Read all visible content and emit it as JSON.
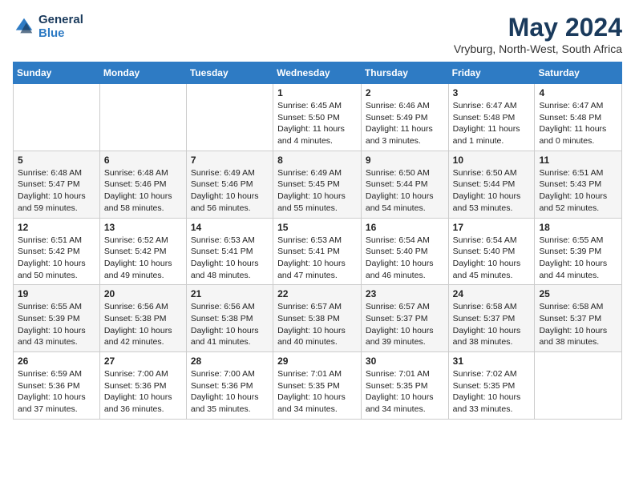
{
  "header": {
    "logo_line1": "General",
    "logo_line2": "Blue",
    "title": "May 2024",
    "location": "Vryburg, North-West, South Africa"
  },
  "days_of_week": [
    "Sunday",
    "Monday",
    "Tuesday",
    "Wednesday",
    "Thursday",
    "Friday",
    "Saturday"
  ],
  "weeks": [
    [
      {
        "day": "",
        "info": ""
      },
      {
        "day": "",
        "info": ""
      },
      {
        "day": "",
        "info": ""
      },
      {
        "day": "1",
        "info": "Sunrise: 6:45 AM\nSunset: 5:50 PM\nDaylight: 11 hours\nand 4 minutes."
      },
      {
        "day": "2",
        "info": "Sunrise: 6:46 AM\nSunset: 5:49 PM\nDaylight: 11 hours\nand 3 minutes."
      },
      {
        "day": "3",
        "info": "Sunrise: 6:47 AM\nSunset: 5:48 PM\nDaylight: 11 hours\nand 1 minute."
      },
      {
        "day": "4",
        "info": "Sunrise: 6:47 AM\nSunset: 5:48 PM\nDaylight: 11 hours\nand 0 minutes."
      }
    ],
    [
      {
        "day": "5",
        "info": "Sunrise: 6:48 AM\nSunset: 5:47 PM\nDaylight: 10 hours\nand 59 minutes."
      },
      {
        "day": "6",
        "info": "Sunrise: 6:48 AM\nSunset: 5:46 PM\nDaylight: 10 hours\nand 58 minutes."
      },
      {
        "day": "7",
        "info": "Sunrise: 6:49 AM\nSunset: 5:46 PM\nDaylight: 10 hours\nand 56 minutes."
      },
      {
        "day": "8",
        "info": "Sunrise: 6:49 AM\nSunset: 5:45 PM\nDaylight: 10 hours\nand 55 minutes."
      },
      {
        "day": "9",
        "info": "Sunrise: 6:50 AM\nSunset: 5:44 PM\nDaylight: 10 hours\nand 54 minutes."
      },
      {
        "day": "10",
        "info": "Sunrise: 6:50 AM\nSunset: 5:44 PM\nDaylight: 10 hours\nand 53 minutes."
      },
      {
        "day": "11",
        "info": "Sunrise: 6:51 AM\nSunset: 5:43 PM\nDaylight: 10 hours\nand 52 minutes."
      }
    ],
    [
      {
        "day": "12",
        "info": "Sunrise: 6:51 AM\nSunset: 5:42 PM\nDaylight: 10 hours\nand 50 minutes."
      },
      {
        "day": "13",
        "info": "Sunrise: 6:52 AM\nSunset: 5:42 PM\nDaylight: 10 hours\nand 49 minutes."
      },
      {
        "day": "14",
        "info": "Sunrise: 6:53 AM\nSunset: 5:41 PM\nDaylight: 10 hours\nand 48 minutes."
      },
      {
        "day": "15",
        "info": "Sunrise: 6:53 AM\nSunset: 5:41 PM\nDaylight: 10 hours\nand 47 minutes."
      },
      {
        "day": "16",
        "info": "Sunrise: 6:54 AM\nSunset: 5:40 PM\nDaylight: 10 hours\nand 46 minutes."
      },
      {
        "day": "17",
        "info": "Sunrise: 6:54 AM\nSunset: 5:40 PM\nDaylight: 10 hours\nand 45 minutes."
      },
      {
        "day": "18",
        "info": "Sunrise: 6:55 AM\nSunset: 5:39 PM\nDaylight: 10 hours\nand 44 minutes."
      }
    ],
    [
      {
        "day": "19",
        "info": "Sunrise: 6:55 AM\nSunset: 5:39 PM\nDaylight: 10 hours\nand 43 minutes."
      },
      {
        "day": "20",
        "info": "Sunrise: 6:56 AM\nSunset: 5:38 PM\nDaylight: 10 hours\nand 42 minutes."
      },
      {
        "day": "21",
        "info": "Sunrise: 6:56 AM\nSunset: 5:38 PM\nDaylight: 10 hours\nand 41 minutes."
      },
      {
        "day": "22",
        "info": "Sunrise: 6:57 AM\nSunset: 5:38 PM\nDaylight: 10 hours\nand 40 minutes."
      },
      {
        "day": "23",
        "info": "Sunrise: 6:57 AM\nSunset: 5:37 PM\nDaylight: 10 hours\nand 39 minutes."
      },
      {
        "day": "24",
        "info": "Sunrise: 6:58 AM\nSunset: 5:37 PM\nDaylight: 10 hours\nand 38 minutes."
      },
      {
        "day": "25",
        "info": "Sunrise: 6:58 AM\nSunset: 5:37 PM\nDaylight: 10 hours\nand 38 minutes."
      }
    ],
    [
      {
        "day": "26",
        "info": "Sunrise: 6:59 AM\nSunset: 5:36 PM\nDaylight: 10 hours\nand 37 minutes."
      },
      {
        "day": "27",
        "info": "Sunrise: 7:00 AM\nSunset: 5:36 PM\nDaylight: 10 hours\nand 36 minutes."
      },
      {
        "day": "28",
        "info": "Sunrise: 7:00 AM\nSunset: 5:36 PM\nDaylight: 10 hours\nand 35 minutes."
      },
      {
        "day": "29",
        "info": "Sunrise: 7:01 AM\nSunset: 5:35 PM\nDaylight: 10 hours\nand 34 minutes."
      },
      {
        "day": "30",
        "info": "Sunrise: 7:01 AM\nSunset: 5:35 PM\nDaylight: 10 hours\nand 34 minutes."
      },
      {
        "day": "31",
        "info": "Sunrise: 7:02 AM\nSunset: 5:35 PM\nDaylight: 10 hours\nand 33 minutes."
      },
      {
        "day": "",
        "info": ""
      }
    ]
  ]
}
